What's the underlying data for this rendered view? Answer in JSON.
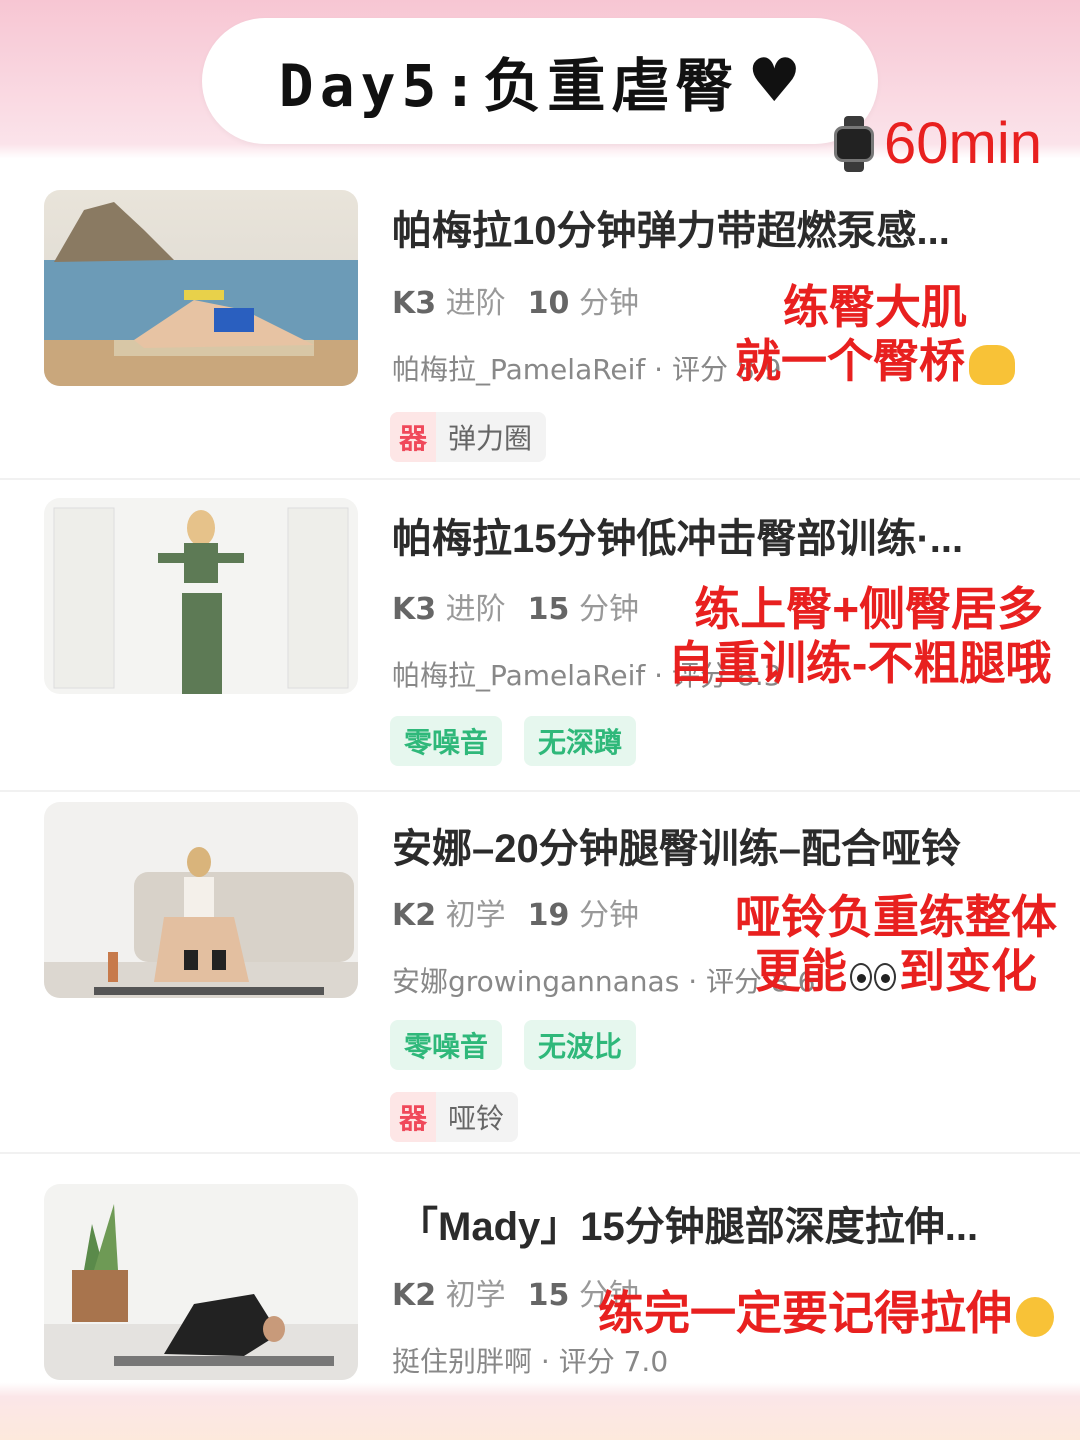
{
  "header": {
    "title": "Day5:负重虐臀",
    "heart": "♥",
    "duration": "60min"
  },
  "courses": [
    {
      "title": "帕梅拉10分钟弹力带超燃泵感...",
      "level": "K3",
      "level_name": "进阶",
      "minutes": "10",
      "minutes_unit": "分钟",
      "author": "帕梅拉_PamelaReif · 评分 8.9",
      "tags": [],
      "equipment_badge": "器",
      "equipment": "弹力圈",
      "note_lines": [
        "练臀大肌",
        "就一个臀桥"
      ]
    },
    {
      "title": "帕梅拉15分钟低冲击臀部训练·...",
      "level": "K3",
      "level_name": "进阶",
      "minutes": "15",
      "minutes_unit": "分钟",
      "author": "帕梅拉_PamelaReif · 评分 8.3",
      "tags": [
        "零噪音",
        "无深蹲"
      ],
      "note_lines": [
        "练上臀+侧臀居多",
        "自重训练-不粗腿哦"
      ]
    },
    {
      "title": "安娜–20分钟腿臀训练–配合哑铃",
      "level": "K2",
      "level_name": "初学",
      "minutes": "19",
      "minutes_unit": "分钟",
      "author": "安娜growingannanas · 评分 8.6",
      "tags": [
        "零噪音",
        "无波比"
      ],
      "equipment_badge": "器",
      "equipment": "哑铃",
      "note_lines": [
        "哑铃负重练整体",
        "更能",
        "到变化"
      ]
    },
    {
      "title": "「Mady」15分钟腿部深度拉伸...",
      "level": "K2",
      "level_name": "初学",
      "minutes": "15",
      "minutes_unit": "分钟",
      "author": "挺住别胖啊 · 评分 7.0",
      "tags": [],
      "note_lines": [
        "练完一定要记得拉伸"
      ]
    }
  ],
  "colors": {
    "accent_red": "#e8201f",
    "tag_green": "#2fb87a",
    "equip_red": "#f0485a"
  },
  "icons": [
    "black-heart-icon",
    "watch-icon",
    "call-me-hand-icon",
    "eyes-icon",
    "ok-hand-icon"
  ]
}
